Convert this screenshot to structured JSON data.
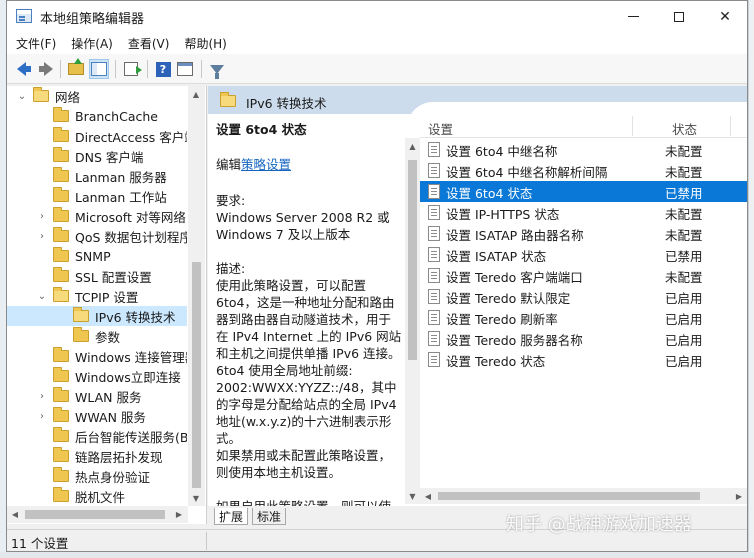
{
  "window": {
    "title": "本地组策略编辑器"
  },
  "menu": [
    "文件(F)",
    "操作(A)",
    "查看(V)",
    "帮助(H)"
  ],
  "toolbar": {
    "icons": [
      "back-arrow-icon",
      "forward-arrow-icon",
      "folder-up-icon",
      "show-hide-tree-icon",
      "export-list-icon",
      "help-icon",
      "properties-icon",
      "filter-icon"
    ]
  },
  "tree": {
    "items": [
      {
        "label": "网络",
        "expanded": true,
        "level": 0
      },
      {
        "label": "BranchCache",
        "level": 1
      },
      {
        "label": "DirectAccess 客户端",
        "level": 1
      },
      {
        "label": "DNS 客户端",
        "level": 1
      },
      {
        "label": "Lanman 服务器",
        "level": 1
      },
      {
        "label": "Lanman 工作站",
        "level": 1
      },
      {
        "label": "Microsoft 对等网络",
        "level": 1,
        "has_children": true
      },
      {
        "label": "QoS 数据包计划程序",
        "level": 1,
        "has_children": true
      },
      {
        "label": "SNMP",
        "level": 1
      },
      {
        "label": "SSL 配置设置",
        "level": 1
      },
      {
        "label": "TCPIP 设置",
        "level": 1,
        "expanded": true
      },
      {
        "label": "IPv6 转换技术",
        "level": 2,
        "selected": true
      },
      {
        "label": "参数",
        "level": 2
      },
      {
        "label": "Windows 连接管理器",
        "level": 1
      },
      {
        "label": "Windows立即连接",
        "level": 1
      },
      {
        "label": "WLAN 服务",
        "level": 1,
        "has_children": true
      },
      {
        "label": "WWAN 服务",
        "level": 1,
        "has_children": true
      },
      {
        "label": "后台智能传送服务(BITS)",
        "level": 1
      },
      {
        "label": "链路层拓扑发现",
        "level": 1
      },
      {
        "label": "热点身份验证",
        "level": 1
      },
      {
        "label": "脱机文件",
        "level": 1
      }
    ]
  },
  "category_header": "IPv6 转换技术",
  "description": {
    "title": "设置 6to4 状态",
    "edit_prefix": "编辑",
    "edit_link": "策略设置",
    "requirements_label": "要求:",
    "requirements_text": "Windows Server 2008 R2 或 Windows 7 及以上版本",
    "desc_label": "描述:",
    "desc_text": "使用此策略设置，可以配置 6to4，这是一种地址分配和路由器到路由器自动隧道技术，用于在 IPv4 Internet 上的 IPv6 网站和主机之间提供单播 IPv6 连接。6to4 使用全局地址前缀: 2002:WWXX:YYZZ::/48，其中的字母是分配给站点的全局 IPv4 地址(w.x.y.z)的十六进制表示形式。",
    "disabled_text": "如果禁用或未配置此策略设置，则使用本地主机设置。",
    "enabled_text": "如果启用此策略设置，则可以使用"
  },
  "list": {
    "columns": {
      "setting": "设置",
      "state": "状态"
    },
    "rows": [
      {
        "name": "设置 6to4 中继名称",
        "state": "未配置"
      },
      {
        "name": "设置 6to4 中继名称解析间隔",
        "state": "未配置"
      },
      {
        "name": "设置 6to4 状态",
        "state": "已禁用",
        "selected": true
      },
      {
        "name": "设置 IP-HTTPS 状态",
        "state": "未配置"
      },
      {
        "name": "设置 ISATAP 路由器名称",
        "state": "未配置"
      },
      {
        "name": "设置 ISATAP 状态",
        "state": "已禁用"
      },
      {
        "name": "设置 Teredo 客户端端口",
        "state": "未配置"
      },
      {
        "name": "设置 Teredo 默认限定",
        "state": "已启用"
      },
      {
        "name": "设置 Teredo 刷新率",
        "state": "已启用"
      },
      {
        "name": "设置 Teredo 服务器名称",
        "state": "已启用"
      },
      {
        "name": "设置 Teredo 状态",
        "state": "已启用"
      }
    ]
  },
  "tabs": [
    "扩展",
    "标准"
  ],
  "status": {
    "text": "11 个设置"
  },
  "watermark": "知乎 @战神游戏加速器",
  "colors": {
    "selection": "#0a78d7",
    "tree_selection": "#cce8ff",
    "header_band": "#cddcec",
    "link": "#1565c0"
  }
}
